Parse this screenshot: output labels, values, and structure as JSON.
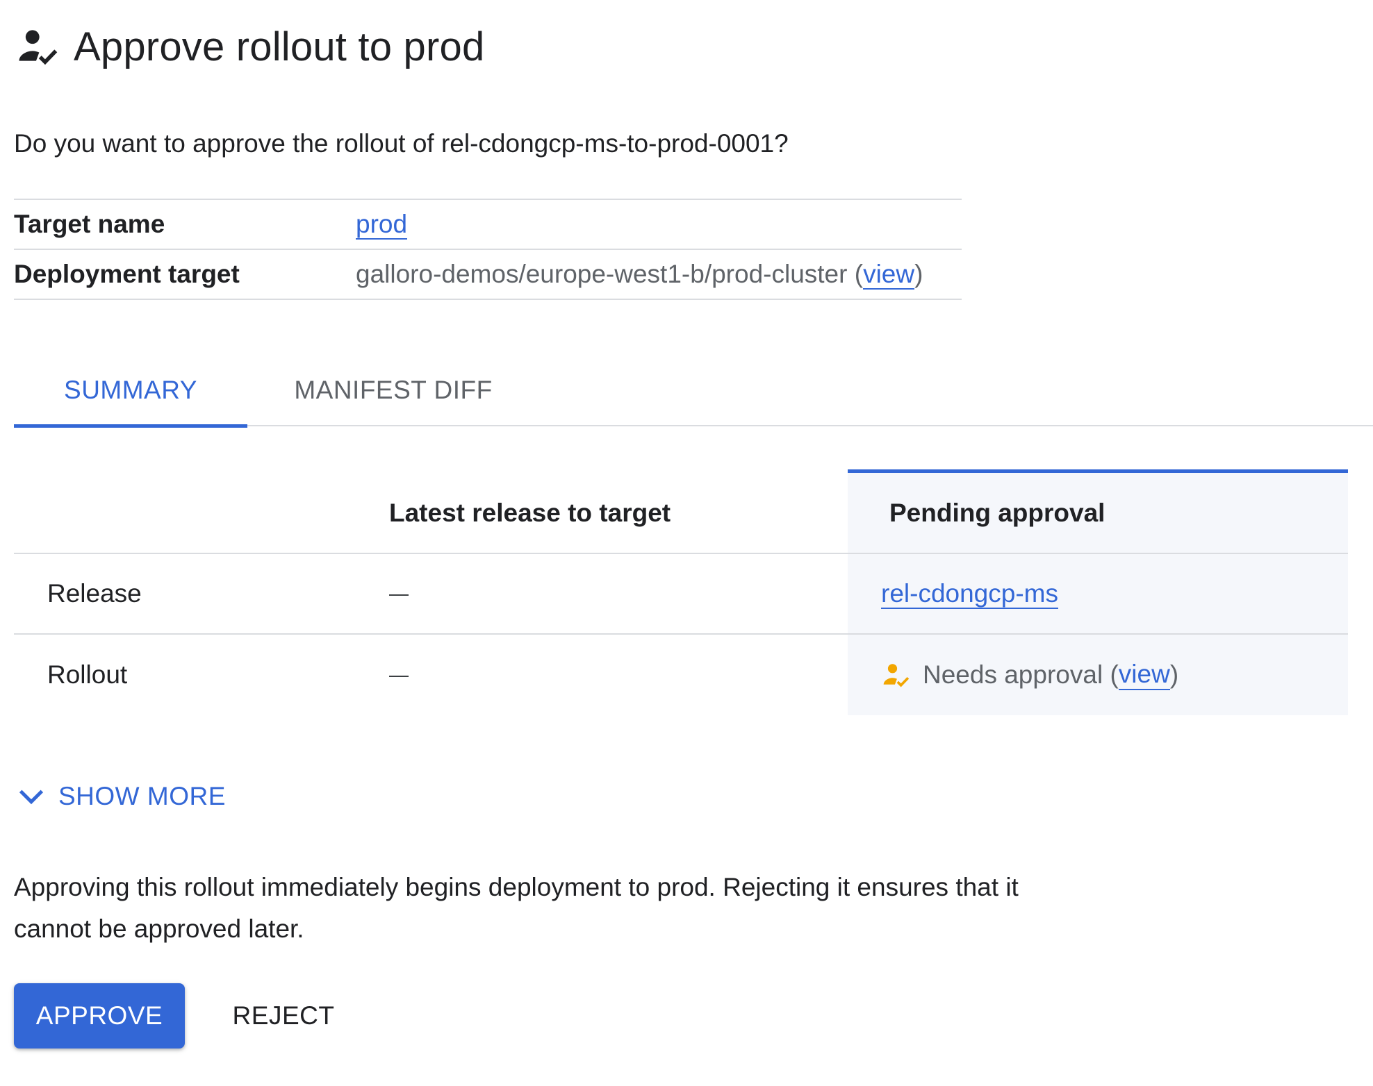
{
  "header": {
    "icon": "approval-person-check-icon",
    "title": "Approve rollout to prod"
  },
  "question": "Do you want to approve the rollout of rel-cdongcp-ms-to-prod-0001?",
  "info": {
    "target_name_label": "Target name",
    "target_name_value": "prod",
    "deployment_target_label": "Deployment target",
    "deployment_target_value": "galloro-demos/europe-west1-b/prod-cluster",
    "open_paren": "(",
    "view_link": "view",
    "close_paren": ")"
  },
  "tabs": [
    {
      "label": "SUMMARY",
      "active": true
    },
    {
      "label": "MANIFEST DIFF",
      "active": false
    }
  ],
  "compare": {
    "latest_header": "Latest release to target",
    "pending_header": "Pending approval",
    "rows": {
      "release": {
        "label": "Release",
        "latest": "—",
        "pending": "rel-cdongcp-ms"
      },
      "rollout": {
        "label": "Rollout",
        "latest": "—",
        "pending_status": "Needs approval",
        "open_paren": "(",
        "view_link": "view",
        "close_paren": ")"
      }
    }
  },
  "show_more": {
    "icon": "chevron-down-icon",
    "label": "SHOW MORE"
  },
  "description_line1": "Approving this rollout immediately begins deployment to prod. Rejecting it ensures that it",
  "description_line2": "cannot be approved later.",
  "buttons": {
    "approve": "APPROVE",
    "reject": "REJECT"
  },
  "colors": {
    "accent": "#3367d6",
    "pending_bg": "#f5f7fb",
    "status_icon": "#f2a600",
    "divider": "#dadce0"
  }
}
